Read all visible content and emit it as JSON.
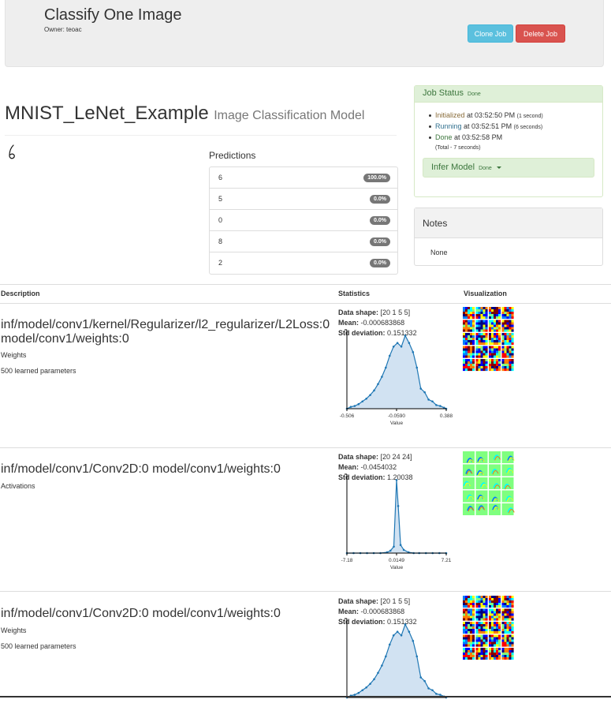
{
  "header": {
    "title": "Classify One Image",
    "owner": "Owner: teoac",
    "clone_label": "Clone Job",
    "delete_label": "Delete Job"
  },
  "model": {
    "name": "MNIST_LeNet_Example",
    "type": "Image Classification Model"
  },
  "predictions": {
    "title": "Predictions",
    "items": [
      {
        "label": "6",
        "value": "100.0%"
      },
      {
        "label": "5",
        "value": "0.0%"
      },
      {
        "label": "0",
        "value": "0.0%"
      },
      {
        "label": "8",
        "value": "0.0%"
      },
      {
        "label": "2",
        "value": "0.0%"
      }
    ]
  },
  "job_status": {
    "title": "Job Status",
    "state": "Done",
    "entries": [
      {
        "state": "Initialized",
        "time": "at 03:52:50 PM",
        "duration": "(1 second)"
      },
      {
        "state": "Running",
        "time": "at 03:52:51 PM",
        "duration": "(6 seconds)"
      },
      {
        "state": "Done",
        "time": "at 03:52:58 PM",
        "duration": ""
      }
    ],
    "total": "(Total - 7 seconds)",
    "infer_title": "Infer Model",
    "infer_state": "Done"
  },
  "notes": {
    "title": "Notes",
    "body": "None"
  },
  "table": {
    "headers": {
      "description": "Description",
      "statistics": "Statistics",
      "visualization": "Visualization"
    },
    "stat_labels": {
      "shape": "Data shape:",
      "mean": "Mean:",
      "std": "Std deviation:"
    },
    "axis_label": "Value",
    "layers": [
      {
        "name_line1": "inf/model/conv1/kernel/Regularizer/l2_regularizer/L2Loss:0",
        "name_line2": "model/conv1/weights:0",
        "kind": "Weights",
        "params": "500 learned parameters",
        "shape": "[20 1 5 5]",
        "mean": "-0.000683868",
        "std": "0.151332",
        "ticks": [
          "-0.506",
          "-0.0590",
          "0.388"
        ]
      },
      {
        "name_line1": "inf/model/conv1/Conv2D:0 model/conv1/weights:0",
        "name_line2": "",
        "kind": "Activations",
        "params": "",
        "shape": "[20 24 24]",
        "mean": "-0.0454032",
        "std": "1.20038",
        "ticks": [
          "-7.18",
          "0.0149",
          "7.21"
        ]
      },
      {
        "name_line1": "inf/model/conv1/Conv2D:0 model/conv1/weights:0",
        "name_line2": "",
        "kind": "Weights",
        "params": "500 learned parameters",
        "shape": "[20 1 5 5]",
        "mean": "-0.000683868",
        "std": "0.151332",
        "ticks": [
          "",
          "",
          ""
        ]
      }
    ]
  },
  "chart_data": [
    {
      "type": "area",
      "xlabel": "Value",
      "x_ticks": [
        "-0.506",
        "-0.0590",
        "0.388"
      ],
      "x": [
        -0.506,
        -0.471,
        -0.436,
        -0.401,
        -0.366,
        -0.331,
        -0.296,
        -0.261,
        -0.226,
        -0.191,
        -0.156,
        -0.121,
        -0.086,
        -0.051,
        -0.016,
        0.019,
        0.054,
        0.089,
        0.124,
        0.159,
        0.194,
        0.229,
        0.264,
        0.299,
        0.334,
        0.369,
        0.388
      ],
      "y": [
        0,
        2,
        3,
        5,
        8,
        11,
        15,
        20,
        27,
        35,
        45,
        58,
        68,
        72,
        68,
        80,
        72,
        62,
        45,
        22,
        18,
        10,
        8,
        4,
        3,
        1,
        0
      ]
    },
    {
      "type": "area",
      "xlabel": "Value",
      "x_ticks": [
        "-7.18",
        "0.0149",
        "7.21"
      ],
      "x": [
        -7.18,
        -6.21,
        -5.23,
        -4.26,
        -3.29,
        -2.32,
        -1.35,
        -0.87,
        -0.38,
        0.0149,
        0.25,
        0.6,
        1.06,
        1.75,
        2.49,
        3.29,
        4.27,
        5.24,
        6.22,
        7.21
      ],
      "y": [
        0,
        0,
        0,
        0,
        0,
        0,
        1,
        3,
        8,
        90,
        58,
        10,
        4,
        1,
        0,
        0,
        0,
        0,
        0,
        0
      ]
    },
    {
      "type": "area",
      "xlabel": "",
      "x_ticks": [],
      "x": [
        -0.506,
        -0.471,
        -0.436,
        -0.401,
        -0.366,
        -0.331,
        -0.296,
        -0.261,
        -0.226,
        -0.191,
        -0.156,
        -0.121,
        -0.086,
        -0.051,
        -0.016,
        0.019,
        0.054,
        0.089,
        0.124,
        0.159,
        0.194,
        0.229,
        0.264,
        0.299,
        0.334,
        0.369,
        0.388
      ],
      "y": [
        0,
        2,
        3,
        5,
        8,
        11,
        15,
        20,
        27,
        35,
        45,
        58,
        68,
        72,
        68,
        80,
        72,
        62,
        45,
        22,
        18,
        10,
        8,
        4,
        3,
        1,
        0
      ]
    }
  ],
  "colors": {
    "line": "#1f77b4",
    "fill": "#c6dbef",
    "clone": "#5bc0de",
    "delete": "#d9534f",
    "success_bg": "#dff0d8",
    "success_text": "#3c763d"
  }
}
